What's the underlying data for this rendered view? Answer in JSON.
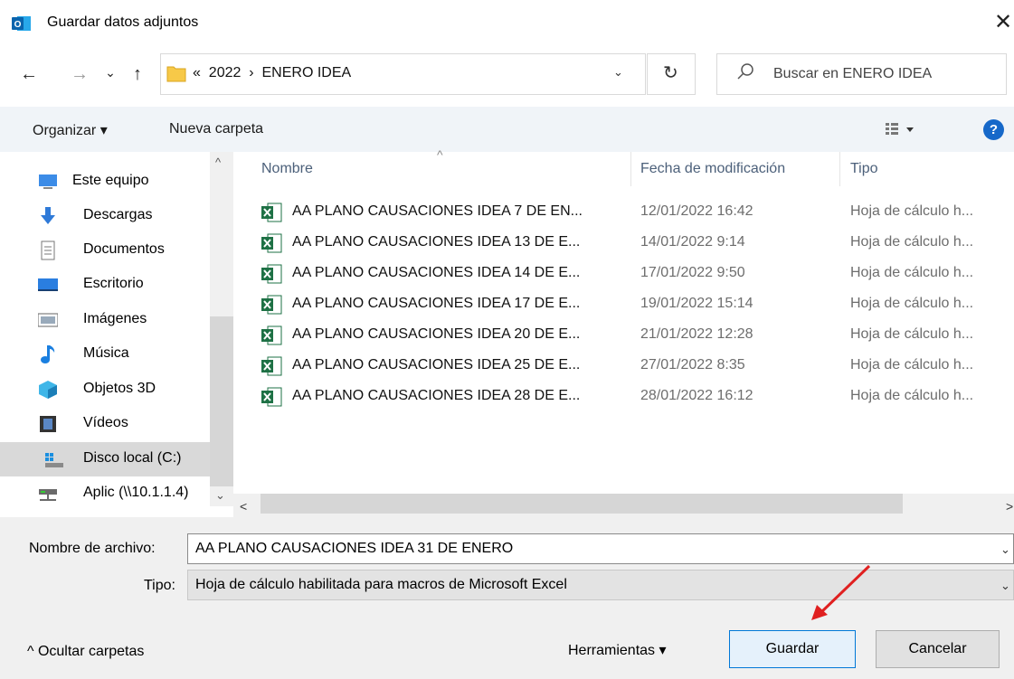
{
  "window": {
    "title": "Guardar datos adjuntos",
    "close_glyph": "✕",
    "app_icon_letter": "O"
  },
  "nav": {
    "back_glyph": "←",
    "forward_glyph": "→",
    "recent_glyph": "⌄",
    "up_glyph": "↑",
    "breadcrumb": "«  2022  ›  ENERO IDEA",
    "dropdown_glyph": "⌄",
    "refresh_glyph": "↻",
    "search_placeholder": "Buscar en ENERO IDEA"
  },
  "toolbar": {
    "organize": "Organizar ▾",
    "new_folder": "Nueva carpeta",
    "view_dd": "▾",
    "help": "?"
  },
  "sidebar": {
    "items": [
      {
        "label": "Este equipo",
        "icon": "pc-icon"
      },
      {
        "label": "Descargas",
        "icon": "download-icon"
      },
      {
        "label": "Documentos",
        "icon": "document-icon"
      },
      {
        "label": "Escritorio",
        "icon": "desktop-icon"
      },
      {
        "label": "Imágenes",
        "icon": "pictures-icon"
      },
      {
        "label": "Música",
        "icon": "music-icon"
      },
      {
        "label": "Objetos 3D",
        "icon": "3d-objects-icon"
      },
      {
        "label": "Vídeos",
        "icon": "video-icon"
      },
      {
        "label": "Disco local (C:)",
        "icon": "drive-icon"
      },
      {
        "label": "Aplic (\\\\10.1.1.4)",
        "icon": "network-drive-icon"
      }
    ],
    "scroll_up": "^",
    "scroll_down": "⌄"
  },
  "file_list": {
    "columns": [
      "Nombre",
      "Fecha de modificación",
      "Tipo"
    ],
    "sort_glyph": "^",
    "rows": [
      {
        "name": "AA PLANO CAUSACIONES IDEA 7 DE EN...",
        "date": "12/01/2022 16:42",
        "type": "Hoja de cálculo h..."
      },
      {
        "name": "AA PLANO CAUSACIONES IDEA 13 DE E...",
        "date": "14/01/2022 9:14",
        "type": "Hoja de cálculo h..."
      },
      {
        "name": "AA PLANO CAUSACIONES IDEA 14 DE E...",
        "date": "17/01/2022 9:50",
        "type": "Hoja de cálculo h..."
      },
      {
        "name": "AA PLANO CAUSACIONES IDEA 17 DE E...",
        "date": "19/01/2022 15:14",
        "type": "Hoja de cálculo h..."
      },
      {
        "name": "AA PLANO CAUSACIONES IDEA 20 DE E...",
        "date": "21/01/2022 12:28",
        "type": "Hoja de cálculo h..."
      },
      {
        "name": "AA PLANO CAUSACIONES IDEA 25 DE E...",
        "date": "27/01/2022 8:35",
        "type": "Hoja de cálculo h..."
      },
      {
        "name": "AA PLANO CAUSACIONES IDEA 28 DE E...",
        "date": "28/01/2022 16:12",
        "type": "Hoja de cálculo h..."
      }
    ],
    "hscroll_left": "<",
    "hscroll_right": ">"
  },
  "form": {
    "filename_label": "Nombre de archivo:",
    "filename_value": "AA PLANO CAUSACIONES IDEA 31 DE ENERO",
    "type_label": "Tipo:",
    "type_value": "Hoja de cálculo habilitada para macros de Microsoft Excel",
    "dd_glyph": "⌄"
  },
  "footer": {
    "hide_folders": "^  Ocultar carpetas",
    "tools": "Herramientas   ▾",
    "save": "Guardar",
    "cancel": "Cancelar"
  },
  "colors": {
    "accent": "#0078d7",
    "help": "#1668c9",
    "excel_green": "#1e7145",
    "annotation_arrow": "#e02020"
  }
}
